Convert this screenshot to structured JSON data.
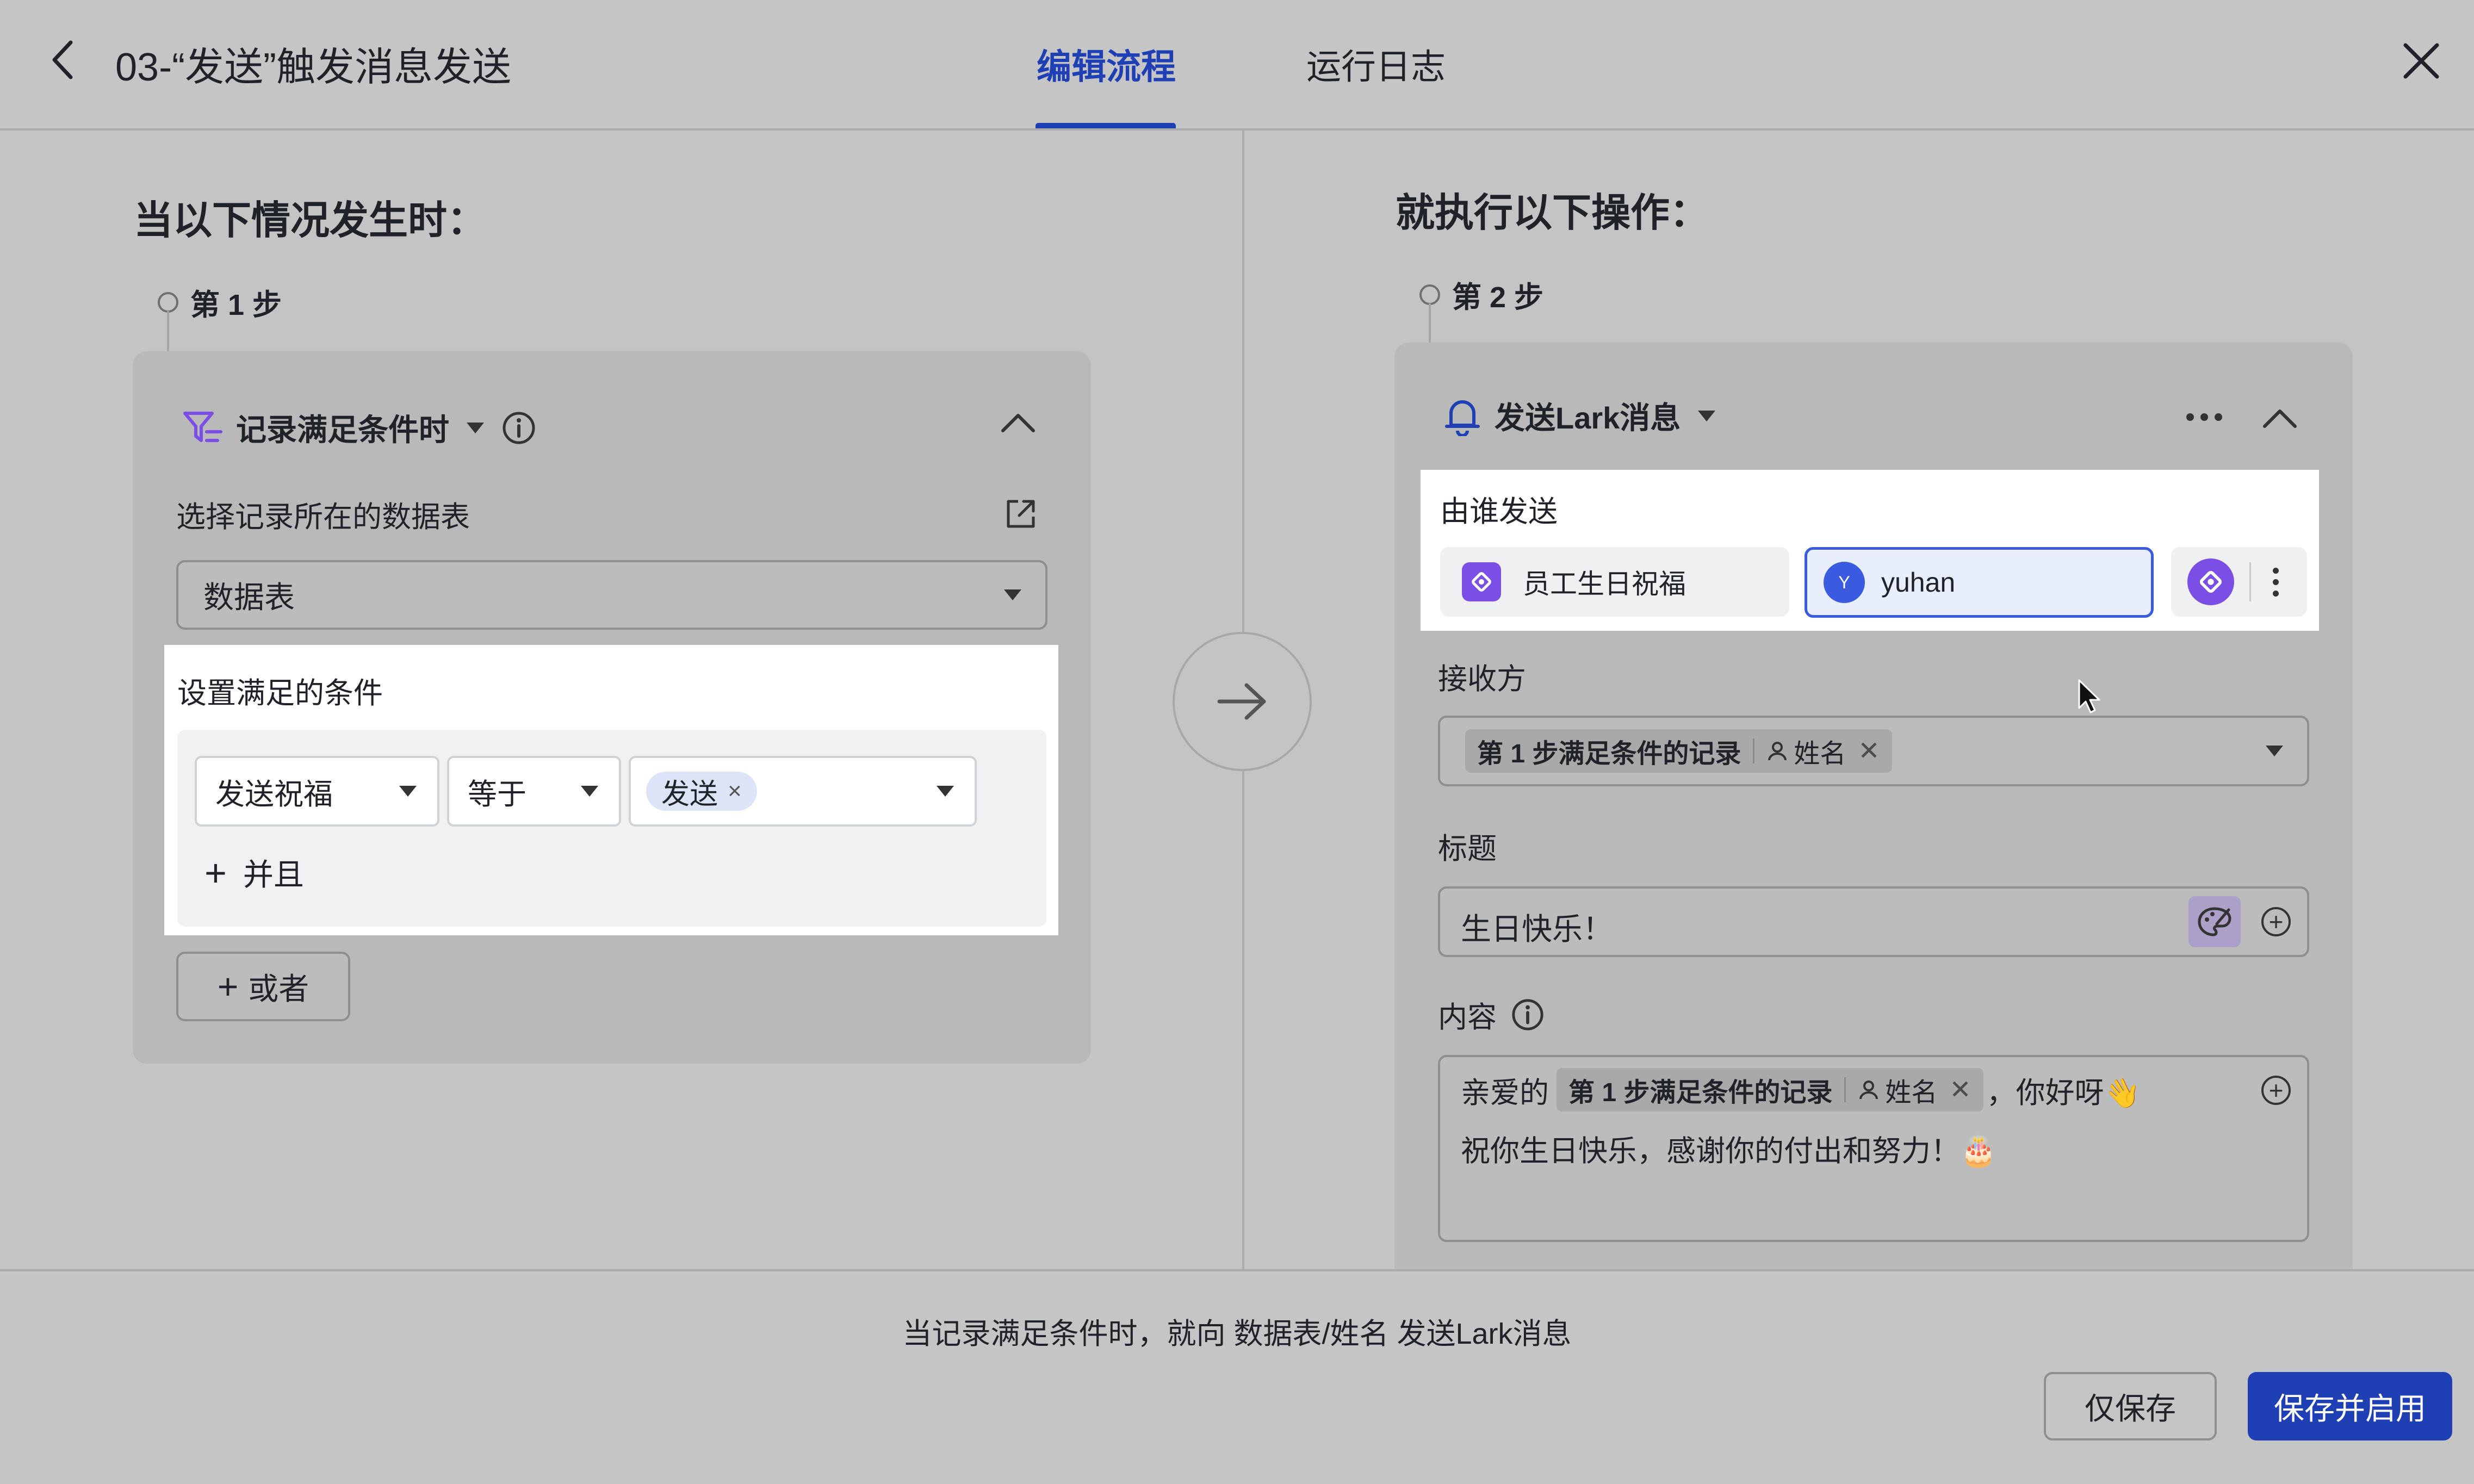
{
  "header": {
    "title": "03-“发送”触发消息发送",
    "tabs": [
      {
        "label": "编辑流程",
        "active": true
      },
      {
        "label": "运行日志",
        "active": false
      }
    ]
  },
  "left": {
    "heading": "当以下情况发生时：",
    "step_label": "第 1 步",
    "card": {
      "trigger_title": "记录满足条件时",
      "table_label": "选择记录所在的数据表",
      "table_value": "数据表",
      "conditions_label": "设置满足的条件",
      "condition": {
        "field": "发送祝福",
        "operator": "等于",
        "value_chip": "发送"
      },
      "add_and_label": "并且",
      "add_or_label": "或者"
    }
  },
  "right": {
    "heading": "就执行以下操作：",
    "step_label": "第 2 步",
    "card": {
      "action_title": "发送Lark消息",
      "sender_label": "由谁发送",
      "sender_bot": "员工生日祝福",
      "sender_user": "yuhan",
      "sender_user_initial": "Y",
      "recipient_label": "接收方",
      "recipient_chip_record": "第 1 步满足条件的记录",
      "recipient_chip_field": "姓名",
      "subject_label": "标题",
      "subject_value": "生日快乐！",
      "content_label": "内容",
      "content_prefix": "亲爱的",
      "content_chip_record": "第 1 步满足条件的记录",
      "content_chip_field": "姓名",
      "content_suffix": "，你好呀👋",
      "content_line2": "祝你生日快乐，感谢你的付出和努力！🎂"
    }
  },
  "footer": {
    "summary": "当记录满足条件时，就向 数据表/姓名 发送Lark消息",
    "save_only": "仅保存",
    "save_enable": "保存并启用"
  },
  "colors": {
    "accent": "#1f3fb5",
    "brand_purple": "#7b4ee6",
    "overlay_gray": "#c4c4c4",
    "highlight": "#ffffff"
  }
}
